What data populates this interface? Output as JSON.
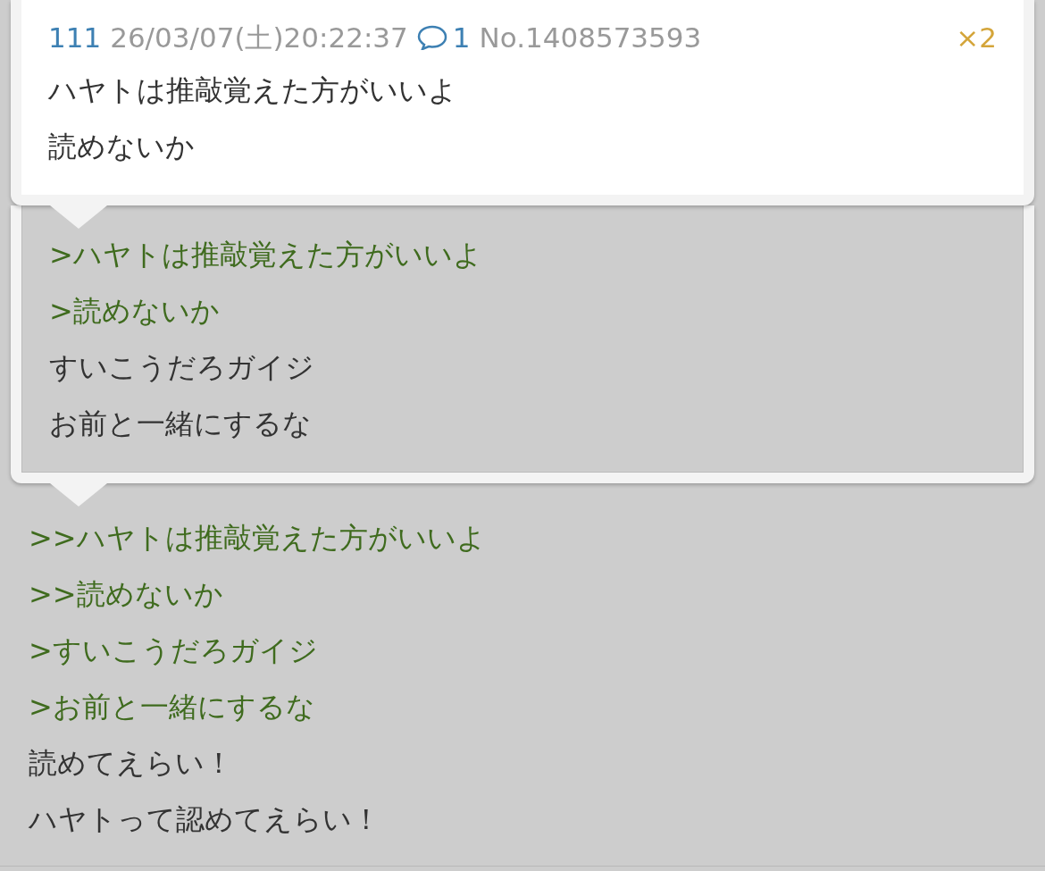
{
  "popups": [
    {
      "header": {
        "number": "111",
        "datetime": "26/03/07(土)20:22:37",
        "reply_count": "1",
        "post_no": "No.1408573593",
        "multiplier": "×2"
      },
      "lines": [
        {
          "kind": "text",
          "text": "ハヤトは推敲覚えた方がいいよ"
        },
        {
          "kind": "text",
          "text": "読めないか"
        }
      ]
    },
    {
      "lines": [
        {
          "kind": "quote",
          "text": ">ハヤトは推敲覚えた方がいいよ"
        },
        {
          "kind": "quote",
          "text": ">読めないか"
        },
        {
          "kind": "text",
          "text": "すいこうだろガイジ"
        },
        {
          "kind": "text",
          "text": "お前と一緒にするな"
        }
      ]
    }
  ],
  "post": {
    "lines": [
      {
        "kind": "quote",
        "text": ">>ハヤトは推敲覚えた方がいいよ"
      },
      {
        "kind": "quote",
        "text": ">>読めないか"
      },
      {
        "kind": "quote",
        "text": ">すいこうだろガイジ"
      },
      {
        "kind": "quote",
        "text": ">お前と一緒にするな"
      },
      {
        "kind": "text",
        "text": "読めてえらい！"
      },
      {
        "kind": "text",
        "text": "ハヤトって認めてえらい！"
      }
    ]
  }
}
